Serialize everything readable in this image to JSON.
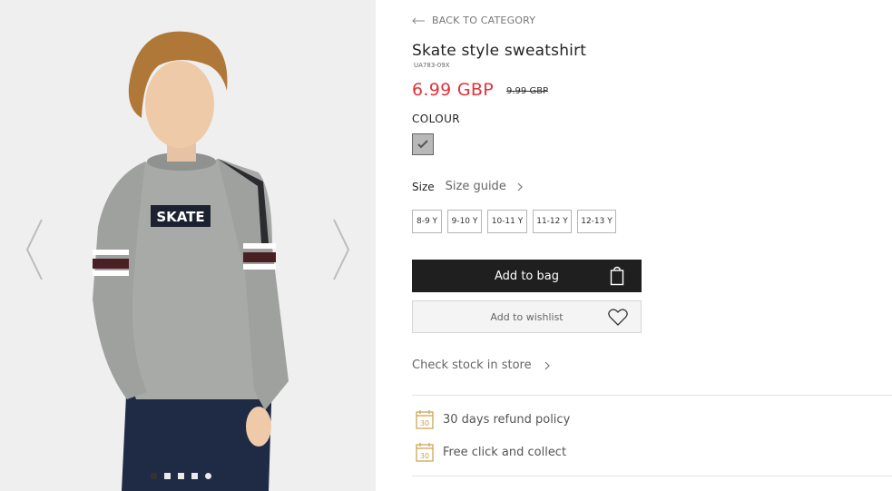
{
  "gallery": {
    "graphic_text": "SKATE",
    "dots_count": 5,
    "active_dot": 1
  },
  "product": {
    "back_label": "BACK TO CATEGORY",
    "title": "Skate style sweatshirt",
    "sku": "UA783-09X",
    "price": "6.99 GBP",
    "old_price": "9.99 GBP",
    "colour_label": "COLOUR",
    "size_label": "Size",
    "size_guide_label": "Size guide",
    "sizes": [
      "8-9 Y",
      "9-10 Y",
      "10-11 Y",
      "11-12 Y",
      "12-13 Y"
    ],
    "add_to_bag_label": "Add to bag",
    "wishlist_label": "Add to wishlist",
    "check_stock_label": "Check stock in store",
    "perks": [
      {
        "icon": "calendar-30-icon",
        "text": "30 days refund policy",
        "badge": "30"
      },
      {
        "icon": "calendar-30-icon",
        "text": "Free click and collect",
        "badge": "30"
      }
    ]
  },
  "colors": {
    "price": "#e3323a",
    "bag_button": "#1f1f1f",
    "perk_icon": "#c9a14a"
  }
}
